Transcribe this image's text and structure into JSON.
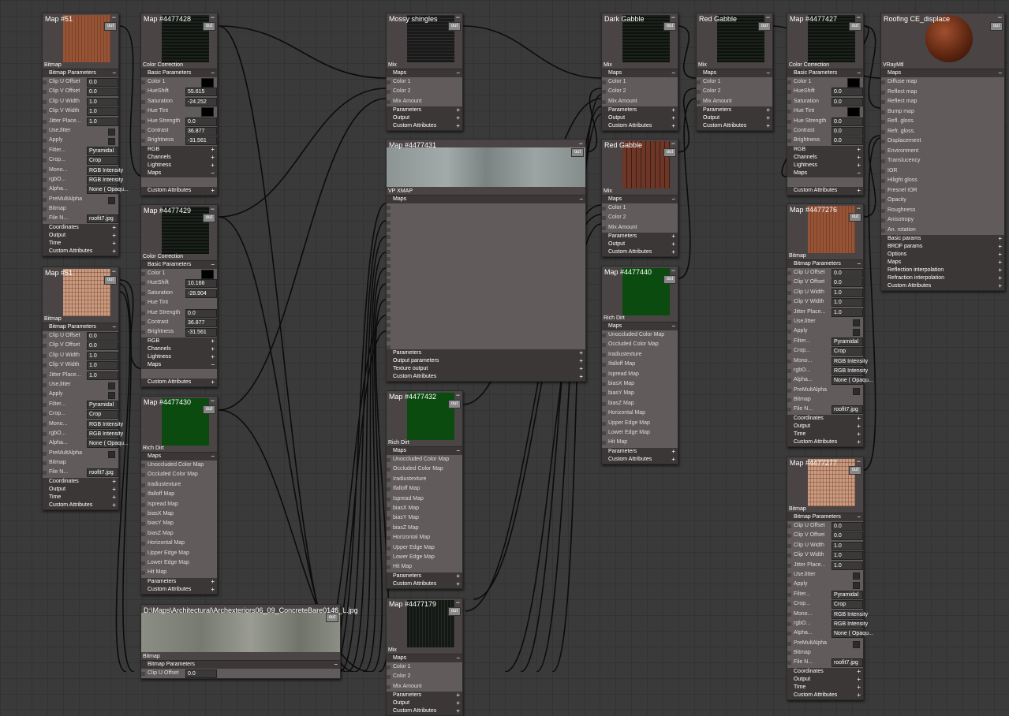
{
  "nodes": {
    "map51a": {
      "title": "Map #51",
      "type": "Bitmap"
    },
    "map51b": {
      "title": "Map #51",
      "type": "Bitmap"
    },
    "m4477428": {
      "title": "Map #4477428",
      "type": "Color Correction"
    },
    "m4477429": {
      "title": "Map #4477429",
      "type": "Color Correction"
    },
    "m4477430": {
      "title": "Map #4477430",
      "type": "Rich Dirt"
    },
    "concrete": {
      "title": "D:\\Maps\\Architectural\\Archexteriors06_09_ConcreteBare0146_L.jpg",
      "type": "Bitmap"
    },
    "mossy": {
      "title": "Mossy shingles",
      "type": "Mix"
    },
    "m4477431": {
      "title": "Map #4477431",
      "type": "VP XMAP"
    },
    "m4477432": {
      "title": "Map #4477432",
      "type": "Rich Dirt"
    },
    "m4477179": {
      "title": "Map #4477179",
      "type": "Mix"
    },
    "darkgabble": {
      "title": "Dark Gabble",
      "type": "Mix"
    },
    "redgabble": {
      "title": "Red Gabble",
      "type": "Mix"
    },
    "m4477440": {
      "title": "Map #4477440",
      "type": "Rich Dirt"
    },
    "redgabble2": {
      "title": "Red Gabble",
      "type": "Mix"
    },
    "m4477427": {
      "title": "Map #4477427",
      "type": "Color Correction"
    },
    "m4477276": {
      "title": "Map #4477276",
      "type": "Bitmap"
    },
    "m4477277": {
      "title": "Map #4477277",
      "type": "Bitmap"
    },
    "roofing": {
      "title": "Roofing CE_displace",
      "type": "VRayMtl"
    }
  },
  "labels": {
    "out": "out",
    "minus": "−",
    "plus": "+",
    "bitmap_params": "Bitmap Parameters",
    "basic_params": "Basic Parameters",
    "maps": "Maps",
    "coordinates": "Coordinates",
    "output": "Output",
    "time": "Time",
    "custom_attributes": "Custom Attributes",
    "rgb": "RGB",
    "channels": "Channels",
    "lightness": "Lightness",
    "parameters": "Parameters",
    "output_parameters": "Output parameters",
    "texture_output": "Texture output",
    "basic_params_lc": "Basic params",
    "brdf_params": "BRDF params",
    "options": "Options",
    "reflection_interp": "Reflection interpolation",
    "refraction_interp": "Refraction interpolation"
  },
  "bitmap_rows": [
    {
      "label": "Clip U Offset",
      "value": "0.0"
    },
    {
      "label": "Clip V Offset",
      "value": "0.0"
    },
    {
      "label": "Clip U Width",
      "value": "1.0"
    },
    {
      "label": "Clip V Width",
      "value": "1.0"
    },
    {
      "label": "Jitter Place...",
      "value": "1.0"
    },
    {
      "label": "UseJitter",
      "check": true
    },
    {
      "label": "Apply",
      "check": true
    },
    {
      "label": "Filter...",
      "value": "Pyramidal"
    },
    {
      "label": "Crop...",
      "value": "Crop"
    },
    {
      "label": "Mono...",
      "value": "RGB Intensity"
    },
    {
      "label": "rgbO...",
      "value": "RGB Intensity"
    },
    {
      "label": "Alpha...",
      "value": "None ( Opaqu..."
    },
    {
      "label": "PreMultAlpha",
      "check": true
    },
    {
      "label": "Bitmap"
    },
    {
      "label": "File N...",
      "value": "roofit7.jpg"
    }
  ],
  "cc_a": [
    {
      "label": "Color 1",
      "swatch": true
    },
    {
      "label": "HueShift",
      "value": "55.615"
    },
    {
      "label": "Saturation",
      "value": "-24.252"
    },
    {
      "label": "Hue Tint",
      "swatch": true
    },
    {
      "label": "Hue Strength",
      "value": "0.0"
    },
    {
      "label": "Contrast",
      "value": "36.877"
    },
    {
      "label": "Brightness",
      "value": "-31.561"
    }
  ],
  "cc_b": [
    {
      "label": "Color 1",
      "swatch": true
    },
    {
      "label": "HueShift",
      "value": "10.166"
    },
    {
      "label": "Saturation",
      "value": "-28.904"
    },
    {
      "label": "Hue Tint"
    },
    {
      "label": "Hue Strength",
      "value": "0.0"
    },
    {
      "label": "Contrast",
      "value": "36.877"
    },
    {
      "label": "Brightness",
      "value": "-31.561"
    }
  ],
  "cc_c": [
    {
      "label": "Color 1",
      "swatch": true
    },
    {
      "label": "HueShift",
      "value": "0.0"
    },
    {
      "label": "Saturation",
      "value": "0.0"
    },
    {
      "label": "Hue Tint",
      "swatch": true
    },
    {
      "label": "Hue Strength",
      "value": "0.0"
    },
    {
      "label": "Contrast",
      "value": "0.0"
    },
    {
      "label": "Brightness",
      "value": "0.0"
    }
  ],
  "mix_rows": [
    "Color 1",
    "Color 2",
    "Mix Amount"
  ],
  "dirt_rows": [
    "Unoccluded Color Map",
    "Occluded Color Map",
    "Iradiustexture",
    "Ifalloff Map",
    "Ispread Map",
    "biasX Map",
    "biasY Map",
    "biasZ Map",
    "Horizontal  Map",
    "Upper Edge Map",
    "Lower Edge Map",
    "Hit Map"
  ],
  "vray_rows": [
    "Diffuse map",
    "Reflect map",
    "Reflect map",
    "Bump map",
    "Refl. gloss.",
    "Refr. gloss.",
    "Displacement",
    "Environment",
    "Translucency",
    "IOR",
    "Hilight gloss",
    "Fresnel IOR",
    "Opacity",
    "Roughness",
    "Anisotropy",
    "An. rotation"
  ],
  "xmap_sockets": 20,
  "concrete_row": {
    "label": "Clip U Offset",
    "value": "0.0"
  }
}
